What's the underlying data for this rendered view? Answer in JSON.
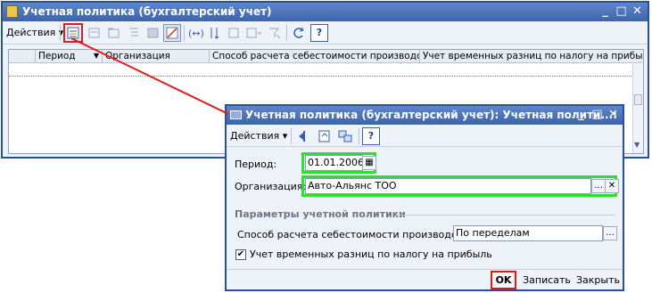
{
  "main_window": {
    "title": "Учетная политика (бухгалтерский учет)",
    "actions_label": "Действия",
    "title_buttons": [
      "_",
      "□",
      "✕"
    ],
    "toolbar_icons": [
      "add-icon",
      "copy-icon",
      "add-group-icon",
      "hierarchy-icon",
      "delete-icon",
      "edit-icon",
      "select-period-icon",
      "sort-icon",
      "filter-icon",
      "filter-list-icon",
      "clear-filter-icon",
      "refresh-icon",
      "help-icon"
    ],
    "columns": [
      "",
      "Период",
      "Организация",
      "Способ расчета себестоимости производства",
      "Учет временных разниц по налогу на прибыль"
    ]
  },
  "dialog": {
    "title": "Учетная политика (бухгалтерский учет): Учетная полити...:",
    "actions_label": "Действия",
    "period_label": "Период:",
    "period_value": "01.01.2006",
    "org_label": "Организация:",
    "org_value": "Авто-Альянс ТОО",
    "section_title": "Параметры учетной политики",
    "method_label": "Способ расчета себестоимости производства:",
    "method_value": "По переделам",
    "tax_diff_label": "Учет временных разниц по налогу на прибыль",
    "tax_diff_checked": "✔",
    "ok_label": "OK",
    "save_label": "Записать",
    "close_label": "Закрыть",
    "ellipsis": "...",
    "clear_glyph": "✕",
    "calendar_glyph": "▦",
    "help_glyph": "?"
  },
  "colors": {
    "highlight_red": "#e01b1b",
    "highlight_green": "#2ee02e",
    "title_blue": "#3d64ab"
  }
}
